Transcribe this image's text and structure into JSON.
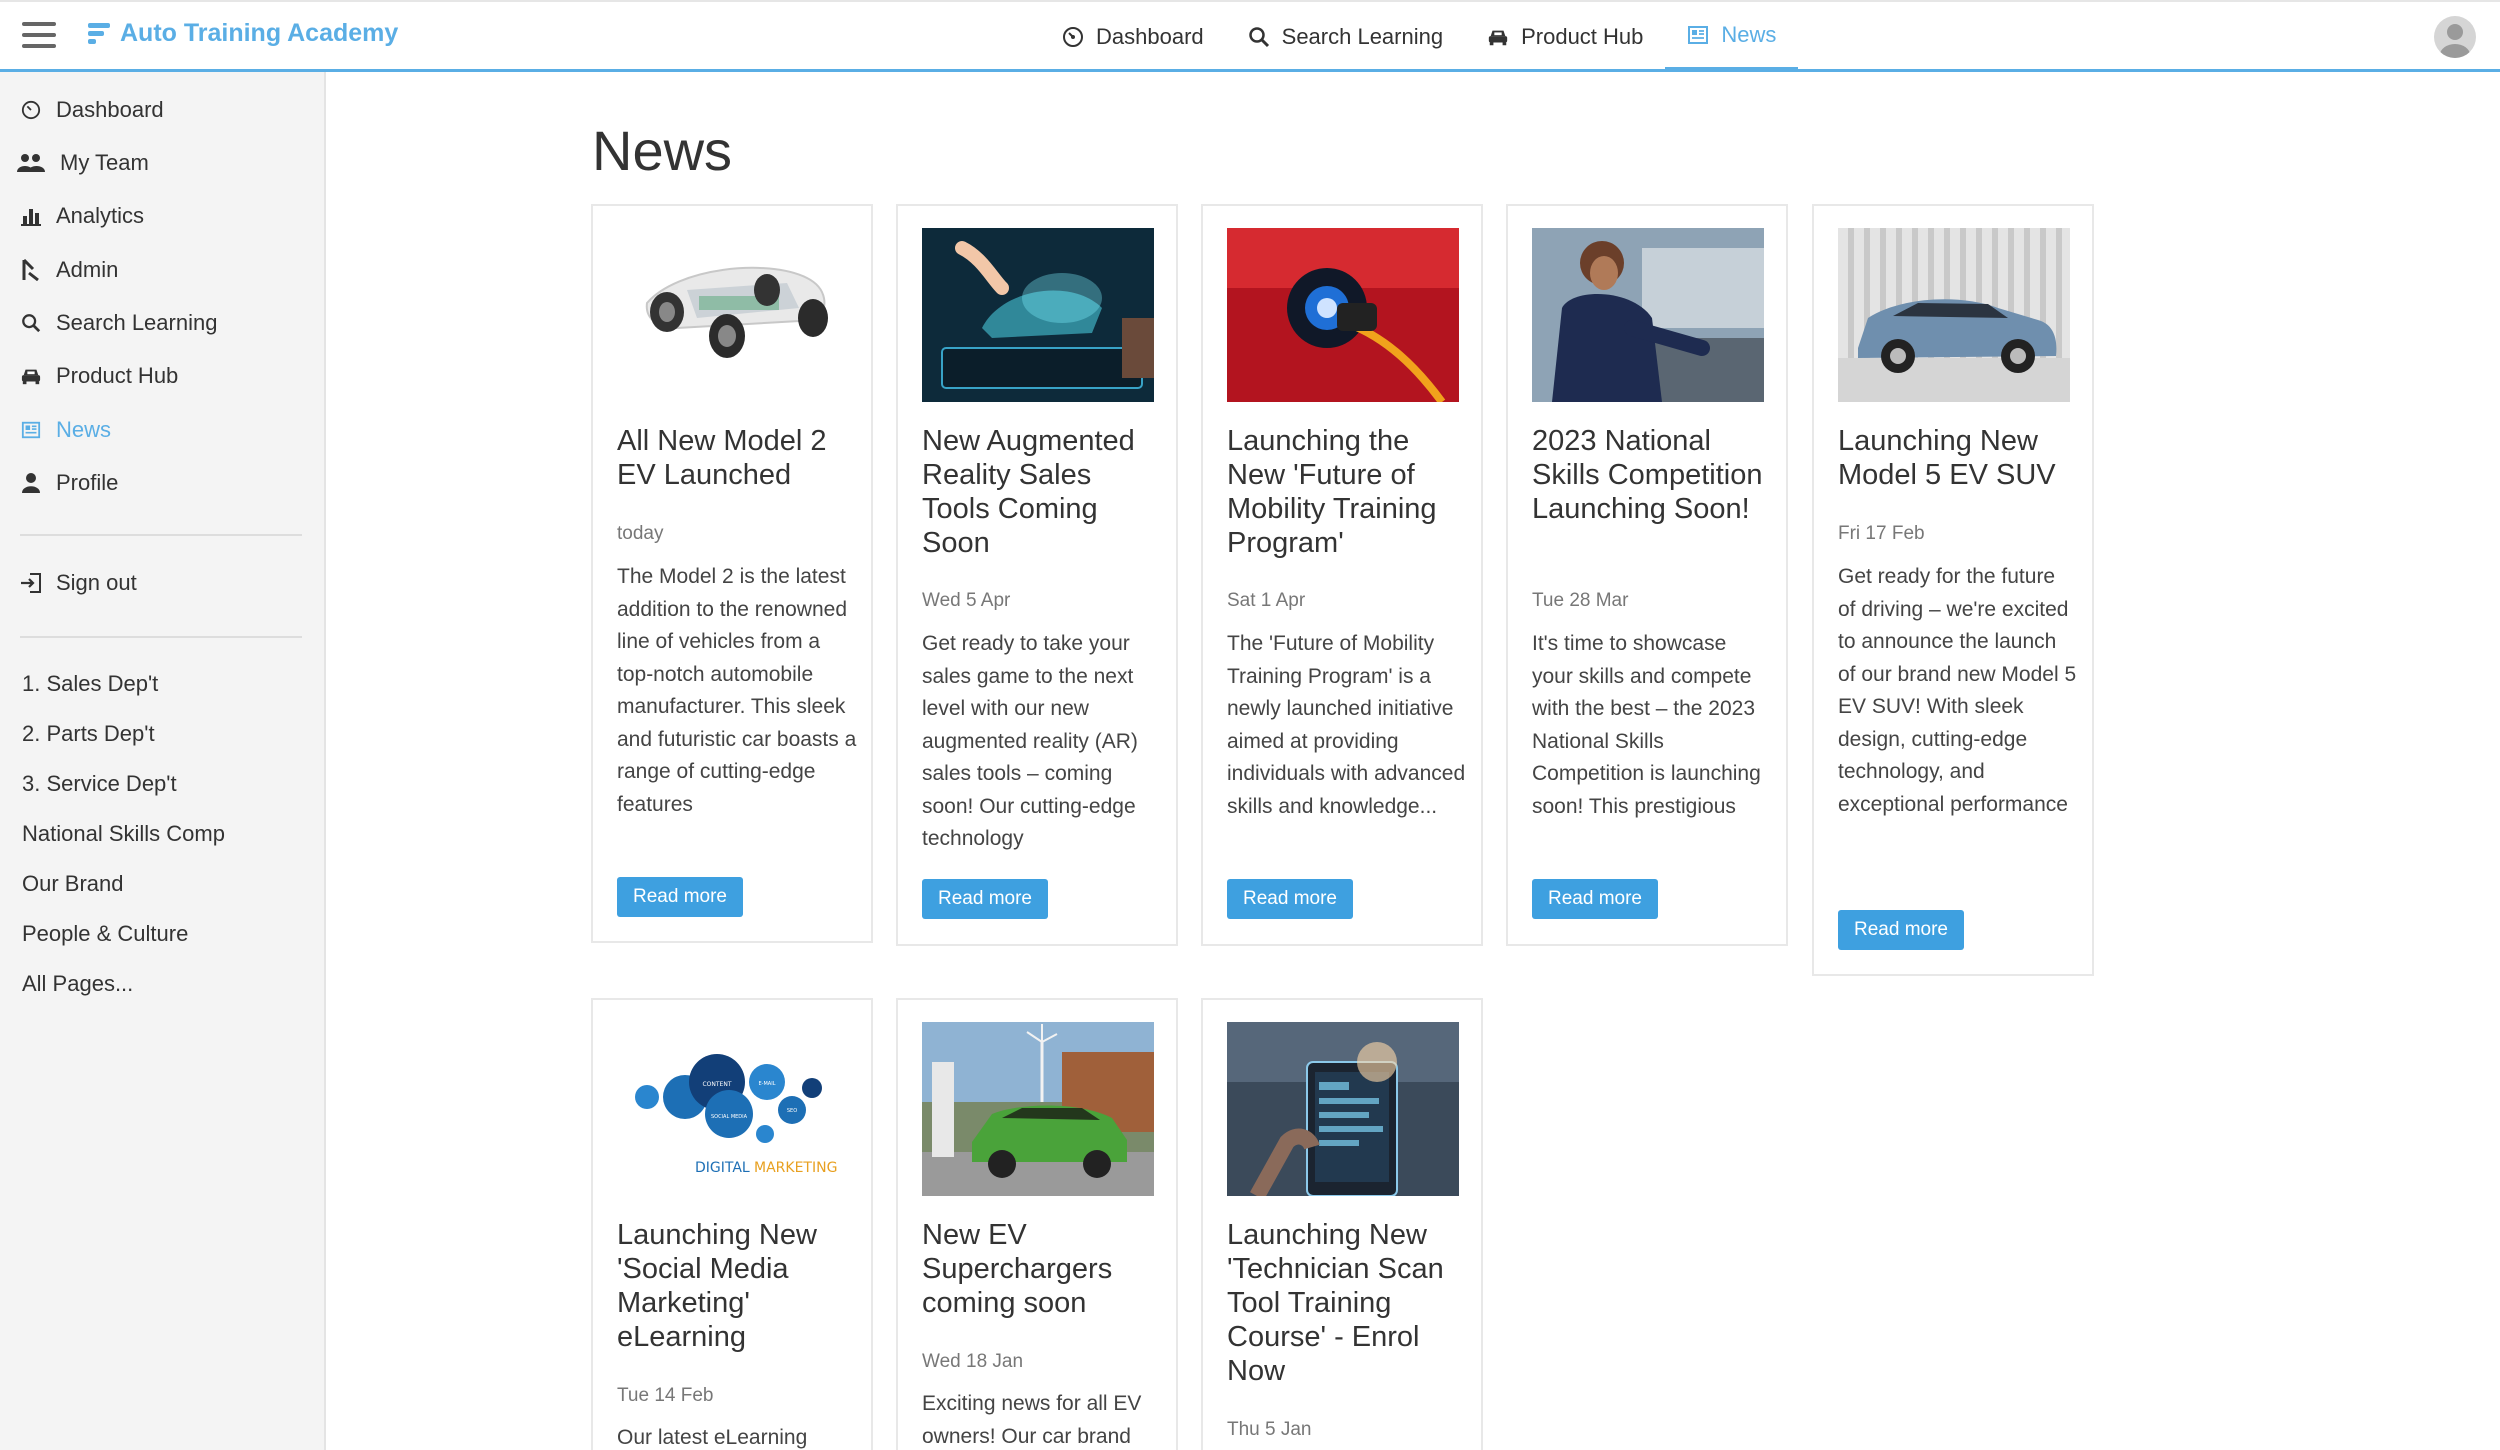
{
  "app": {
    "brand": "Auto Training Academy",
    "accent": "#5aaee5"
  },
  "topnav": {
    "tabs": [
      {
        "label": "Dashboard",
        "icon": "dashboard-icon"
      },
      {
        "label": "Search Learning",
        "icon": "search-icon"
      },
      {
        "label": "Product Hub",
        "icon": "car-icon"
      },
      {
        "label": "News",
        "icon": "news-icon",
        "active": true
      }
    ]
  },
  "sidebar": {
    "items": [
      {
        "label": "Dashboard",
        "icon": "dashboard-icon"
      },
      {
        "label": "My Team",
        "icon": "team-icon"
      },
      {
        "label": "Analytics",
        "icon": "analytics-icon"
      },
      {
        "label": "Admin",
        "icon": "admin-icon"
      },
      {
        "label": "Search Learning",
        "icon": "search-icon"
      },
      {
        "label": "Product Hub",
        "icon": "car-icon"
      },
      {
        "label": "News",
        "icon": "news-icon",
        "active": true
      },
      {
        "label": "Profile",
        "icon": "profile-icon"
      }
    ],
    "signout": "Sign out",
    "links": [
      "1. Sales Dep't",
      "2. Parts Dep't",
      "3. Service Dep't",
      "National Skills Comp",
      "Our Brand",
      "People & Culture",
      "All Pages..."
    ]
  },
  "main": {
    "title": "News",
    "read_more": "Read more",
    "cards": [
      {
        "title": "All New Model 2 EV Launched",
        "date": "today",
        "text": "The Model 2 is the latest addition to the renowned line of vehicles from a top-notch automobile manufacturer. This sleek and futuristic car boasts a range of cutting-edge features",
        "image": "ev-chassis-image"
      },
      {
        "title": "New Augmented Reality Sales Tools Coming Soon",
        "date": "Wed 5 Apr",
        "text": "Get ready to take your sales game to the next level with our new augmented reality (AR) sales tools – coming soon! Our cutting-edge technology",
        "image": "ar-tablet-image"
      },
      {
        "title": "Launching the New 'Future of Mobility Training Program'",
        "date": "Sat 1 Apr",
        "text": "The 'Future of Mobility Training Program' is a newly launched initiative aimed at providing individuals with advanced skills and knowledge...",
        "image": "ev-charging-image"
      },
      {
        "title": "2023 National Skills Competition Launching Soon!",
        "date": "Tue 28 Mar",
        "text": "It's time to showcase your skills and compete with the best – the 2023 National Skills Competition is launching soon! This prestigious",
        "image": "technician-image"
      },
      {
        "title": "Launching New Model 5 EV SUV",
        "date": "Fri 17 Feb",
        "text": "Get ready for the future of driving – we're excited to announce the launch of our brand new Model 5 EV SUV! With sleek design, cutting-edge technology, and exceptional performance",
        "image": "suv-image"
      },
      {
        "title": "Launching New 'Social Media Marketing' eLearning",
        "date": "Tue 14 Feb",
        "text": "Our latest eLearning",
        "image": "digital-marketing-image",
        "image_text": {
          "a": "DIGITAL",
          "b": "MARKETING",
          "c": "CONTENT",
          "d": "SOCIAL MEDIA",
          "e": "E-MAIL",
          "f": "SEO"
        }
      },
      {
        "title": "New EV Superchargers coming soon",
        "date": "Wed 18 Jan",
        "text": "Exciting news for all EV owners! Our car brand",
        "image": "supercharger-image"
      },
      {
        "title": "Launching New 'Technician Scan Tool Training Course' - Enrol Now",
        "date": "Thu 5 Jan",
        "text": "",
        "image": "scan-tool-image"
      }
    ]
  }
}
